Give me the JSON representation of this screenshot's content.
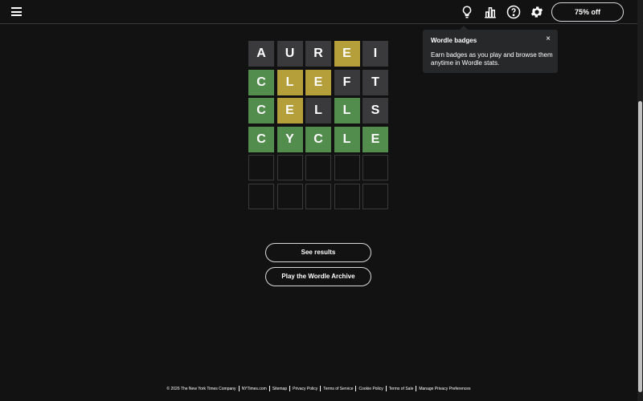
{
  "header": {
    "subscribe_label": "75% off",
    "icons": [
      "menu-icon",
      "lightbulb-icon",
      "stats-icon",
      "help-icon",
      "gear-icon"
    ]
  },
  "board": {
    "rows": [
      [
        {
          "letter": "A",
          "state": "absent"
        },
        {
          "letter": "U",
          "state": "absent"
        },
        {
          "letter": "R",
          "state": "absent"
        },
        {
          "letter": "E",
          "state": "present"
        },
        {
          "letter": "I",
          "state": "absent"
        }
      ],
      [
        {
          "letter": "C",
          "state": "correct"
        },
        {
          "letter": "L",
          "state": "present"
        },
        {
          "letter": "E",
          "state": "present"
        },
        {
          "letter": "F",
          "state": "absent"
        },
        {
          "letter": "T",
          "state": "absent"
        }
      ],
      [
        {
          "letter": "C",
          "state": "correct"
        },
        {
          "letter": "E",
          "state": "present"
        },
        {
          "letter": "L",
          "state": "absent"
        },
        {
          "letter": "L",
          "state": "correct"
        },
        {
          "letter": "S",
          "state": "absent"
        }
      ],
      [
        {
          "letter": "C",
          "state": "correct"
        },
        {
          "letter": "Y",
          "state": "correct"
        },
        {
          "letter": "C",
          "state": "correct"
        },
        {
          "letter": "L",
          "state": "correct"
        },
        {
          "letter": "E",
          "state": "correct"
        }
      ],
      [
        {
          "letter": "",
          "state": "empty"
        },
        {
          "letter": "",
          "state": "empty"
        },
        {
          "letter": "",
          "state": "empty"
        },
        {
          "letter": "",
          "state": "empty"
        },
        {
          "letter": "",
          "state": "empty"
        }
      ],
      [
        {
          "letter": "",
          "state": "empty"
        },
        {
          "letter": "",
          "state": "empty"
        },
        {
          "letter": "",
          "state": "empty"
        },
        {
          "letter": "",
          "state": "empty"
        },
        {
          "letter": "",
          "state": "empty"
        }
      ]
    ]
  },
  "tooltip": {
    "title": "Wordle badges",
    "body": "Earn badges as you play and browse them anytime in Wordle stats.",
    "close": "×"
  },
  "actions": {
    "see_results": "See results",
    "play_archive": "Play the Wordle Archive"
  },
  "footer": {
    "copyright": "© 2026 The New York Times Company",
    "links": [
      "NYTimes.com",
      "Sitemap",
      "Privacy Policy",
      "Terms of Service",
      "Cookie Policy",
      "Terms of Sale",
      "Manage Privacy Preferences"
    ]
  },
  "colors": {
    "background": "#121213",
    "absent": "#3a3a3c",
    "present": "#b59f3b",
    "correct": "#538d4e",
    "tooltip": "#27282a"
  }
}
